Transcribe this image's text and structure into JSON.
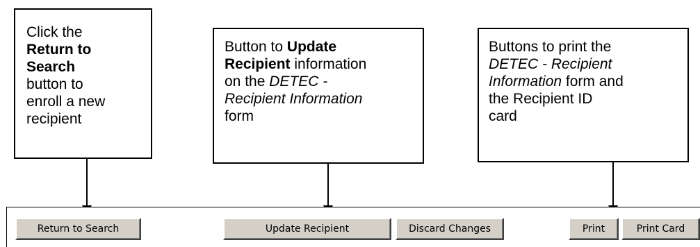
{
  "callouts": {
    "return": {
      "line1": "Click the",
      "line2_bold": "Return to",
      "line3_bold": "Search",
      "line4": "button to",
      "line5": "enroll a new",
      "line6": "recipient"
    },
    "update": {
      "pre": "Button to ",
      "bold1": "Update",
      "bold2": "Recipient",
      "post2": " information",
      "pre3": "on the ",
      "italic3": "DETEC -",
      "italic4": "Recipient Information",
      "line5": "form"
    },
    "print": {
      "line1": "Buttons to print the",
      "italic2": "DETEC - Recipient",
      "italic3": "Information",
      "post3": " form and",
      "line4": "the Recipient ID",
      "line5": "card"
    }
  },
  "buttons": {
    "return_label": "Return to Search",
    "update_label": "Update Recipient",
    "discard_label": "Discard Changes",
    "print_label": "Print",
    "print_card_label": "Print Card"
  }
}
